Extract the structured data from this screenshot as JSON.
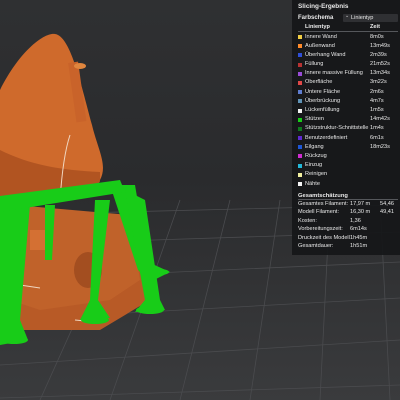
{
  "panel": {
    "title": "Slicing-Ergebnis",
    "color_scheme_label": "Farbschema",
    "color_scheme_value": "Linientyp",
    "col_type": "Linientyp",
    "col_time": "Zeit",
    "features": [
      {
        "name": "Innere Wand",
        "time": "8m0s",
        "color": "#f2cf44"
      },
      {
        "name": "Außenwand",
        "time": "13m49s",
        "color": "#ff8a2a"
      },
      {
        "name": "Überhang Wand",
        "time": "2m39s",
        "color": "#2f4fd8"
      },
      {
        "name": "Füllung",
        "time": "21m52s",
        "color": "#b83232"
      },
      {
        "name": "Innere massive Füllung",
        "time": "13m34s",
        "color": "#9a4cd8"
      },
      {
        "name": "Oberfläche",
        "time": "3m22s",
        "color": "#e04848"
      },
      {
        "name": "Untere Fläche",
        "time": "2m6s",
        "color": "#5f7dd0"
      },
      {
        "name": "Überbrückung",
        "time": "4m7s",
        "color": "#5f93b6"
      },
      {
        "name": "Lückenfüllung",
        "time": "1m5s",
        "color": "#f2f2f2"
      },
      {
        "name": "Stützen",
        "time": "14m42s",
        "color": "#18cc18"
      },
      {
        "name": "Stützstruktur-Schnittstelle",
        "time": "1m4s",
        "color": "#0f7a1e"
      },
      {
        "name": "Benutzerdefiniert",
        "time": "6m1s",
        "color": "#5e2ad0"
      },
      {
        "name": "Eilgang",
        "time": "18m23s",
        "color": "#1d57d6"
      },
      {
        "name": "Rückzug",
        "time": "",
        "color": "#d12bd1"
      },
      {
        "name": "Einzug",
        "time": "",
        "color": "#23b8d8"
      },
      {
        "name": "Reinigen",
        "time": "",
        "color": "#f2f0a0"
      },
      {
        "name": "Nähte",
        "time": "",
        "color": "#f5f5f5"
      }
    ],
    "estimate_title": "Gesamtschätzung",
    "estimates": [
      {
        "label": "Gesamtes Filament:",
        "v1": "17,97 m",
        "v2": "54,46"
      },
      {
        "label": "Modell Filament:",
        "v1": "16,30 m",
        "v2": "49,41"
      },
      {
        "label": "Kosten:",
        "v1": "1,36",
        "v2": ""
      },
      {
        "label": "Vorbereitungszeit:",
        "v1": "6m14s",
        "v2": ""
      },
      {
        "label": "Druckzeit des Modell",
        "v1": "1h45m",
        "v2": ""
      },
      {
        "label": "Gesamtdauer:",
        "v1": "1h51m",
        "v2": ""
      }
    ]
  },
  "viewport": {
    "model_color": "#cf6a2c",
    "support_color": "#18cc18",
    "grid_color": "#4a4b4e"
  }
}
